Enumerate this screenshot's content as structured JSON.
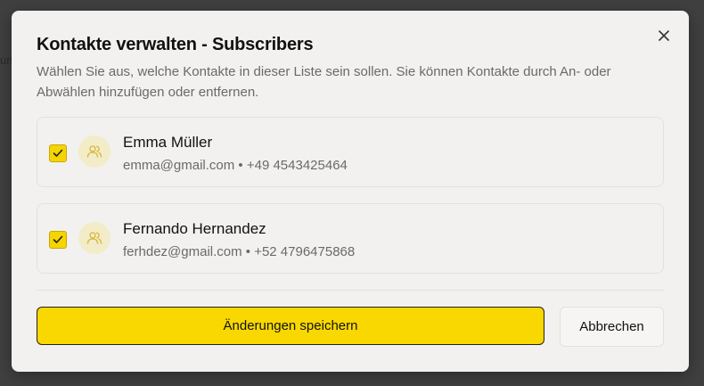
{
  "background": {
    "partial_text": "un"
  },
  "dialog": {
    "title": "Kontakte verwalten - Subscribers",
    "description": "Wählen Sie aus, welche Kontakte in dieser Liste sein sollen. Sie können Kontakte durch An- oder Abwählen hinzufügen oder entfernen.",
    "close_icon": "close-icon"
  },
  "contacts": [
    {
      "name": "Emma Müller",
      "email": "emma@gmail.com",
      "phone": "+49 4543425464",
      "meta": "emma@gmail.com • +49 4543425464",
      "checked": true,
      "icon": "users-icon"
    },
    {
      "name": "Fernando Hernandez",
      "email": "ferhdez@gmail.com",
      "phone": "+52 4796475868",
      "meta": "ferhdez@gmail.com • +52 4796475868",
      "checked": true,
      "icon": "users-icon"
    }
  ],
  "actions": {
    "save_label": "Änderungen speichern",
    "cancel_label": "Abbrechen"
  },
  "colors": {
    "accent": "#f8d800",
    "avatar_bg": "#f3ecc8",
    "modal_bg": "#f2f1ef"
  }
}
